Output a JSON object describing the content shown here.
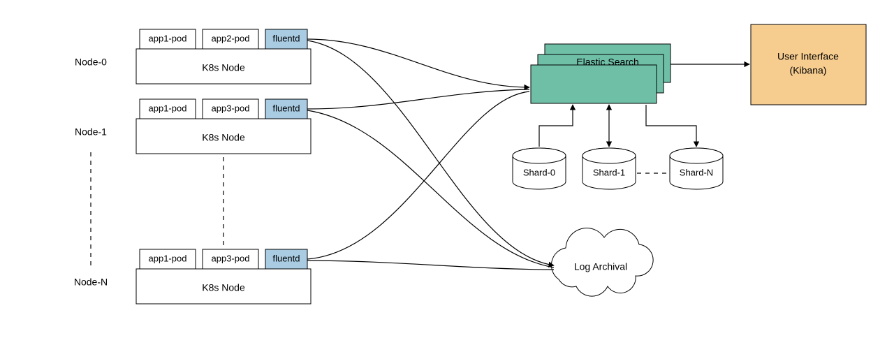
{
  "nodes": {
    "labels": [
      "Node-0",
      "Node-1",
      "Node-N"
    ],
    "container_label": "K8s Node",
    "node0_pods": [
      "app1-pod",
      "app2-pod"
    ],
    "node1_pods": [
      "app1-pod",
      "app3-pod"
    ],
    "nodeN_pods": [
      "app1-pod",
      "app3-pod"
    ],
    "fluentd_label": "fluentd"
  },
  "elastic": {
    "label": "Elastic Search"
  },
  "shards": {
    "labels": [
      "Shard-0",
      "Shard-1",
      "Shard-N"
    ]
  },
  "log_archival": {
    "label": "Log Archival"
  },
  "ui": {
    "line1": "User Interface",
    "line2": "(Kibana)"
  },
  "colors": {
    "fluentd_bg": "#a9cce3",
    "elastic_bg": "#6fbfa7",
    "ui_bg": "#f6cc8f"
  }
}
